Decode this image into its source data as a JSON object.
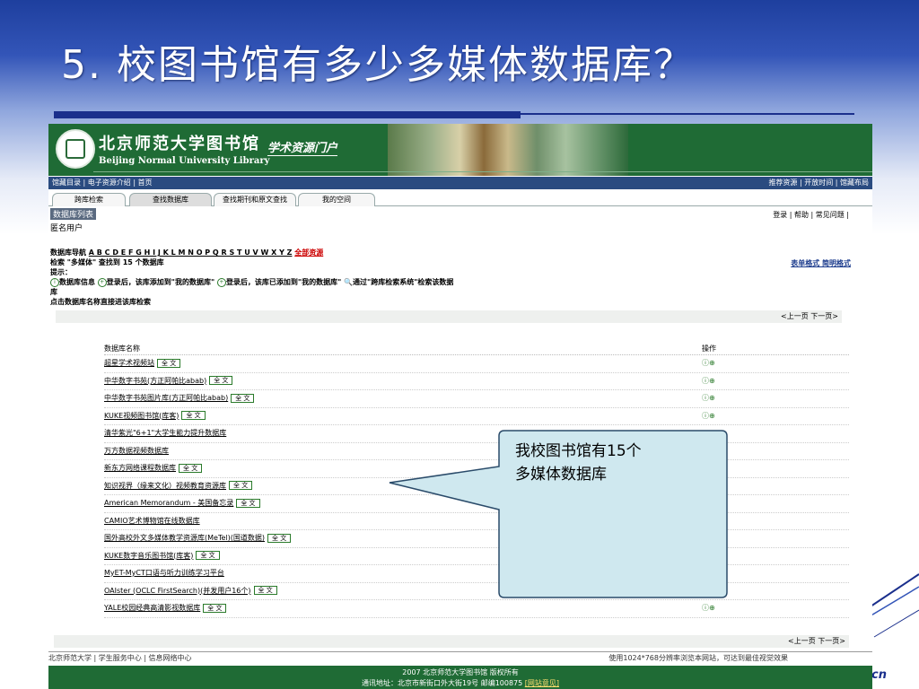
{
  "slide": {
    "title": "5. 校图书馆有多少多媒体数据库？",
    "corner_text": "cn"
  },
  "banner": {
    "logo_cn": "北京师范大学图书馆",
    "logo_en": "Beijing Normal University Library",
    "portal": "学术资源门户"
  },
  "topnav": {
    "left": "馆藏目录 | 电子资源介绍 | 首页",
    "right": "推荐资源 | 开放时间 | 馆藏布局"
  },
  "tabs": [
    "跨库检索",
    "查找数据库",
    "查找期刊和原文查找",
    "我的空间"
  ],
  "content": {
    "list_label": "数据库列表",
    "anon": "匿名用户",
    "toplinks": "登录 | 帮助 | 常见问题 |",
    "alpha_label": "数据库导航",
    "letters": "A B C D E F G H I J K L M N O P Q R S T U V W X Y Z",
    "all_resources": "全部资源",
    "search_result": "检索 \"多媒体\" 查找到 15 个数据库",
    "format_links": "表单格式   简明格式",
    "hint_label": "提示：",
    "hint1": "数据库信息",
    "hint2": "登录后，该库添加到\"我的数据库\"",
    "hint3": "登录后，该库已添加到\"我的数据库\"",
    "hint4": "通过\"跨库检索系统\"检索该数据",
    "hint_wrap": "库",
    "hint_click": "点击数据库名称直接进该库检索",
    "pager": "<上一页 下一页>",
    "col_name": "数据库名称",
    "col_ops": "操作",
    "fulltext": "全 文"
  },
  "databases": [
    {
      "name": "超星学术视频站",
      "fulltext": true,
      "ops": "ⓘ⊕"
    },
    {
      "name": "中华数字书苑(方正阿帕比abab)",
      "fulltext": true,
      "ops": "ⓘ⊕"
    },
    {
      "name": "中华数字书苑图片库(方正阿帕比abab)",
      "fulltext": true,
      "ops": "ⓘ⊕"
    },
    {
      "name": "KUKE视频图书馆(库客)",
      "fulltext": true,
      "ops": "ⓘ⊕"
    },
    {
      "name": "清华紫光\"6+1\"大学生能力提升数据库",
      "fulltext": false,
      "ops": ""
    },
    {
      "name": "万方数据视频数据库",
      "fulltext": false,
      "ops": ""
    },
    {
      "name": "新东方网络课程数据库",
      "fulltext": true,
      "ops": ""
    },
    {
      "name": "知识视界（缘来文化）视频教育资源库",
      "fulltext": true,
      "ops": ""
    },
    {
      "name": "American Memorandum - 美国备忘录",
      "fulltext": true,
      "ops": ""
    },
    {
      "name": "CAMIO艺术博物馆在线数据库",
      "fulltext": false,
      "ops": ""
    },
    {
      "name": "国外高校外文多媒体教学资源库(MeTel)(国道数据)",
      "fulltext": true,
      "ops": ""
    },
    {
      "name": "KUKE数字音乐图书馆(库客)",
      "fulltext": true,
      "ops": ""
    },
    {
      "name": "MyET-MyCT口语与听力训练学习平台",
      "fulltext": false,
      "ops": ""
    },
    {
      "name": "OAIster (OCLC FirstSearch)(并发用户16个)",
      "fulltext": true,
      "ops": "⊕🔍"
    },
    {
      "name": "YALE校园经典高清影视数据库",
      "fulltext": true,
      "ops": "ⓘ⊕"
    }
  ],
  "footer": {
    "left": "北京师范大学 | 学生服务中心 | 信息网络中心",
    "right": "使用1024*768分辨率浏览本网站，可达到最佳视觉效果",
    "copyright": "2007 北京师范大学图书馆 版权所有",
    "address": "通讯地址：北京市新街口外大街19号   邮编100875",
    "feedback": "[网站意见]"
  },
  "callout": {
    "line1": "我校图书馆有15个",
    "line2": "多媒体数据库"
  },
  "colors": {
    "banner": "#1f6b35",
    "nav": "#2a4b80",
    "title_rule": "#1a2f8c",
    "bubble": "#cfe8ef"
  }
}
